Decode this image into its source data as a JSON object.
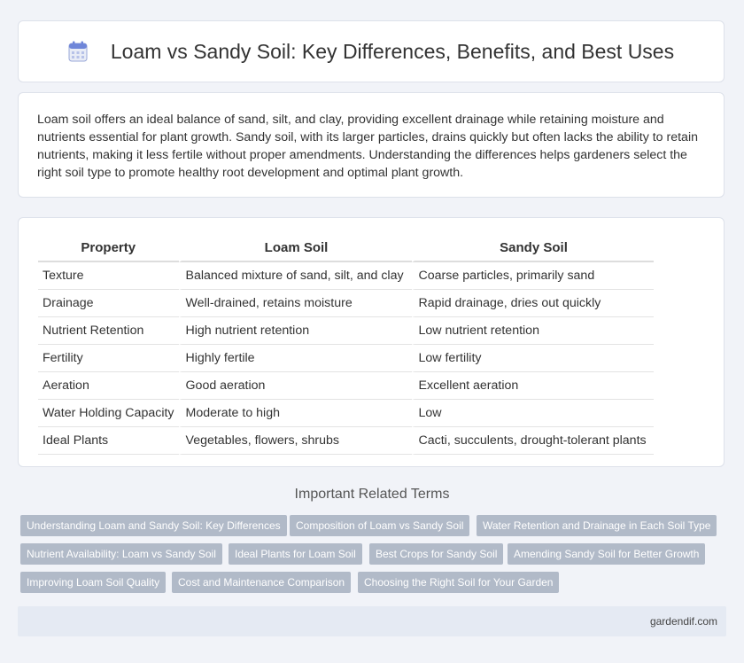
{
  "header": {
    "title": "Loam vs Sandy Soil: Key Differences, Benefits, and Best Uses",
    "icon": "calendar-icon"
  },
  "intro": {
    "text": "Loam soil offers an ideal balance of sand, silt, and clay, providing excellent drainage while retaining moisture and nutrients essential for plant growth. Sandy soil, with its larger particles, drains quickly but often lacks the ability to retain nutrients, making it less fertile without proper amendments. Understanding the differences helps gardeners select the right soil type to promote healthy root development and optimal plant growth."
  },
  "table": {
    "headers": [
      "Property",
      "Loam Soil",
      "Sandy Soil"
    ],
    "rows": [
      [
        "Texture",
        "Balanced mixture of sand, silt, and clay",
        "Coarse particles, primarily sand"
      ],
      [
        "Drainage",
        "Well-drained, retains moisture",
        "Rapid drainage, dries out quickly"
      ],
      [
        "Nutrient Retention",
        "High nutrient retention",
        "Low nutrient retention"
      ],
      [
        "Fertility",
        "Highly fertile",
        "Low fertility"
      ],
      [
        "Aeration",
        "Good aeration",
        "Excellent aeration"
      ],
      [
        "Water Holding Capacity",
        "Moderate to high",
        "Low"
      ],
      [
        "Ideal Plants",
        "Vegetables, flowers, shrubs",
        "Cacti, succulents, drought-tolerant plants"
      ]
    ]
  },
  "related": {
    "title": "Important Related Terms",
    "tags": [
      "Understanding Loam and Sandy Soil: Key Differences",
      "Composition of Loam vs Sandy Soil",
      "Water Retention and Drainage in Each Soil Type",
      "Nutrient Availability: Loam vs Sandy Soil",
      "Ideal Plants for Loam Soil",
      "Best Crops for Sandy Soil",
      "Amending Sandy Soil for Better Growth",
      "Improving Loam Soil Quality",
      "Cost and Maintenance Comparison",
      "Choosing the Right Soil for Your Garden"
    ]
  },
  "footer": {
    "site": "gardendif.com"
  },
  "colors": {
    "accent": "#b1bac8",
    "background": "#f1f3f8"
  }
}
